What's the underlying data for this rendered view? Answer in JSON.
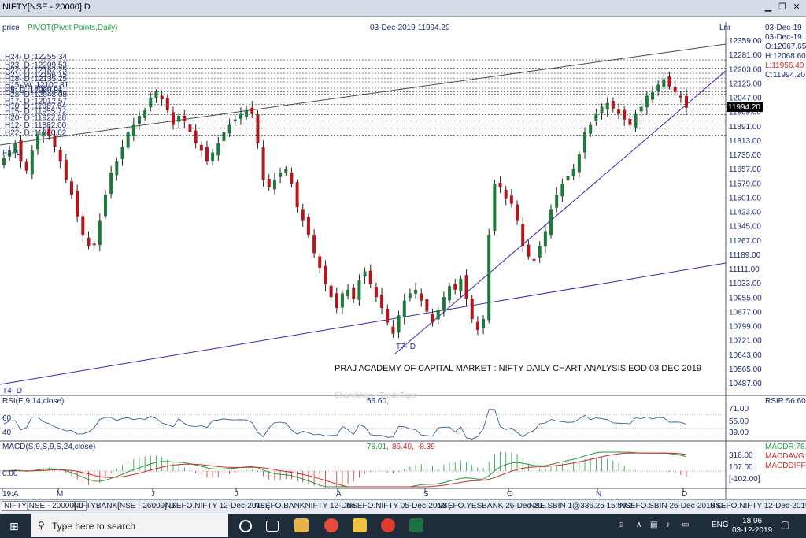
{
  "window": {
    "title": "NIFTY[NSE - 20000] D"
  },
  "chart": {
    "top_left_label": "price",
    "indicator_label": "PIVOT(Pivot Points,Daily)",
    "header_date": "03-Dec-2019 11994.20",
    "lnr_label": "Lnr",
    "info_box": [
      "03-Dec-19",
      "03-Dec-19",
      "O:12067.65",
      "H:12068.60",
      "L:11956.40",
      "C:11994.20"
    ],
    "current_price_tag": "11994.20",
    "fi_label": "F1- D",
    "pivot_labels": [
      "H24- D :12255.34",
      "H23- D :12209.53",
      "H22- D :12182.25",
      "H21- D :12156.15",
      "H18- D :12135.25",
      "H15- W :12100.81",
      "H9- D :12080.61",
      "H5- D :12069.86",
      "H28- D :12048.08",
      "H17- D :12012.57",
      "H10- D :11987.64",
      "H15- D :11955.72",
      "H20- D :11922.28",
      "H12- D :11882.00",
      "H22- D :11840.02"
    ],
    "price_ticks": [
      "12359.00",
      "12281.00",
      "12203.00",
      "12125.00",
      "12047.00",
      "11969.00",
      "11891.00",
      "11813.00",
      "11735.00",
      "11657.00",
      "11579.00",
      "11501.00",
      "11423.00",
      "11345.00",
      "11267.00",
      "11189.00",
      "11111.00",
      "11033.00",
      "10955.00",
      "10877.00",
      "10799.00",
      "10721.00",
      "10643.00",
      "10565.00",
      "10487.00"
    ],
    "month_labels": [
      "19:A",
      "M",
      "J",
      "J",
      "A",
      "S",
      "O",
      "N",
      "D"
    ],
    "t7_label": "T7- D",
    "t4_label": "T4- D",
    "annotation": "PRAJ ACADEMY OF CAPITAL MARKET : NIFTY DAILY CHART ANALYSIS EOD 03 DEC 2019",
    "watermark": "Sharekhan - TradeTiger"
  },
  "rsi": {
    "label": "RSI(E,9,14,close)",
    "value": "56.60,",
    "right_label": "RSIR:56.60",
    "left_ticks": [
      "60",
      "40"
    ],
    "right_ticks": [
      "71.00",
      "55.00",
      "39.00"
    ]
  },
  "macd": {
    "label": "MACD(S,9,S,9,S,24,close)",
    "values_prefix": "78.01,",
    "value_avg": "86.40,",
    "value_diff": "-8.39",
    "left_tick": "0.00",
    "right_ticks": [
      "316.00",
      "107.00",
      "[-102.00]"
    ],
    "legend": [
      "MACDR:78.",
      "MACDAVG:",
      "MACDDIFF:"
    ]
  },
  "tabs": [
    "NIFTY[NSE - 20000] D",
    "NIFTYBANK[NSE - 26009] D",
    "NSEFO.NIFTY 12-Dec-2019 (",
    "NSEFO.BANKNIFTY 12-Dec-",
    "NSEFO.NIFTY 05-Dec-2019 (",
    "NSEFO.YESBANK 26-Dec-20",
    "NSE.SBIN 1@336.25 15:59:2",
    "NSEFO.SBIN 26-Dec-2019 C",
    "NSEFO.NIFTY 12-Dec-2019 PE"
  ],
  "taskbar": {
    "search_placeholder": "Type here to search",
    "lang": "ENG",
    "time": "18:06",
    "date": "03-12-2019"
  },
  "colors": {
    "up": "#1e7a3a",
    "down": "#b5161b",
    "trend": "#2a2ab5",
    "macd": "#1e9c3a",
    "signal": "#cf2a2a"
  },
  "chart_data": {
    "type": "candlestick",
    "title": "PRAJ ACADEMY OF CAPITAL MARKET : NIFTY DAILY CHART ANALYSIS EOD 03 DEC 2019",
    "ylim": [
      10487,
      12359
    ],
    "closes": [
      11720,
      11760,
      11800,
      11700,
      11650,
      11760,
      11850,
      11860,
      11840,
      11780,
      11700,
      11600,
      11520,
      11400,
      11300,
      11240,
      11250,
      11380,
      11520,
      11640,
      11700,
      11780,
      11860,
      11900,
      11950,
      11980,
      12050,
      12080,
      12040,
      11980,
      11900,
      11950,
      11920,
      11860,
      11800,
      11760,
      11700,
      11750,
      11800,
      11860,
      11900,
      11930,
      11960,
      11980,
      11960,
      11800,
      11600,
      11560,
      11600,
      11640,
      11660,
      11580,
      11450,
      11380,
      11300,
      11200,
      11120,
      11030,
      10960,
      10900,
      10980,
      11000,
      10950,
      11050,
      11100,
      11030,
      10960,
      10900,
      10820,
      10760,
      10860,
      10940,
      10980,
      11000,
      10940,
      10880,
      10820,
      10890,
      10960,
      11020,
      11000,
      11060,
      10950,
      10840,
      10780,
      10840,
      11300,
      11580,
      11560,
      11500,
      11470,
      11380,
      11240,
      11180,
      11160,
      11240,
      11320,
      11440,
      11520,
      11580,
      11620,
      11660,
      11740,
      11860,
      11900,
      11960,
      12000,
      12020,
      11990,
      11960,
      11930,
      11900,
      11960,
      12000,
      12060,
      12080,
      12120,
      12150,
      12110,
      12080,
      12050,
      11994.2
    ],
    "rsi": [
      56.6
    ],
    "macd": {
      "macd": 78.01,
      "signal": 86.4,
      "diff": -8.39
    },
    "current": {
      "date": "03-Dec-2019",
      "open": 12067.65,
      "high": 12068.6,
      "low": 11956.4,
      "close": 11994.2
    }
  }
}
